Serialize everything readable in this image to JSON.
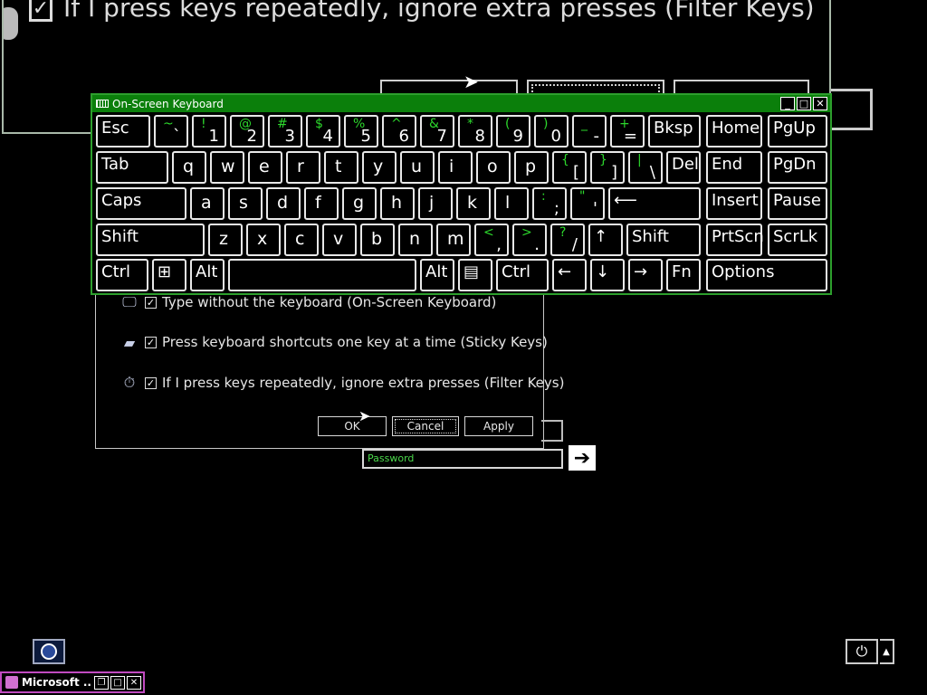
{
  "magnifier": {
    "option_text": "If I press keys repeatedly, ignore extra presses (Filter Keys)"
  },
  "ease_dialog": {
    "options": [
      {
        "label": "Type without the keyboard (On-Screen Keyboard)",
        "checked": true,
        "icon": "monitor-icon"
      },
      {
        "label": "Press keyboard shortcuts one key at a time (Sticky Keys)",
        "checked": true,
        "icon": "keyboard-key-icon"
      },
      {
        "label": "If I press keys repeatedly, ignore extra presses (Filter Keys)",
        "checked": true,
        "icon": "stopwatch-icon"
      }
    ],
    "buttons": {
      "ok": "OK",
      "cancel": "Cancel",
      "apply": "Apply"
    }
  },
  "logon": {
    "password_placeholder": "Password"
  },
  "osk": {
    "title": "On-Screen Keyboard",
    "row1": [
      {
        "s": "~",
        "l": "`"
      },
      {
        "s": "!",
        "l": "1"
      },
      {
        "s": "@",
        "l": "2"
      },
      {
        "s": "#",
        "l": "3"
      },
      {
        "s": "$",
        "l": "4"
      },
      {
        "s": "%",
        "l": "5"
      },
      {
        "s": "^",
        "l": "6"
      },
      {
        "s": "&",
        "l": "7"
      },
      {
        "s": "*",
        "l": "8"
      },
      {
        "s": "(",
        "l": "9"
      },
      {
        "s": ")",
        "l": "0"
      },
      {
        "s": "_",
        "l": "-"
      },
      {
        "s": "+",
        "l": "="
      }
    ],
    "row2_letters": [
      "q",
      "w",
      "e",
      "r",
      "t",
      "y",
      "u",
      "i",
      "o",
      "p"
    ],
    "row2_sym": [
      {
        "s": "{",
        "l": "["
      },
      {
        "s": "}",
        "l": "]"
      },
      {
        "s": "|",
        "l": "\\"
      }
    ],
    "row3_letters": [
      "a",
      "s",
      "d",
      "f",
      "g",
      "h",
      "j",
      "k",
      "l"
    ],
    "row3_sym": [
      {
        "s": ":",
        "l": ";"
      },
      {
        "s": "\"",
        "l": "'"
      }
    ],
    "row4_letters": [
      "z",
      "x",
      "c",
      "v",
      "b",
      "n",
      "m"
    ],
    "row4_sym": [
      {
        "s": "<",
        "l": ","
      },
      {
        "s": ">",
        "l": "."
      },
      {
        "s": "?",
        "l": "/"
      }
    ],
    "labels": {
      "esc": "Esc",
      "bksp": "Bksp",
      "tab": "Tab",
      "del": "Del",
      "caps": "Caps",
      "shift": "Shift",
      "ctrl": "Ctrl",
      "alt": "Alt",
      "fn": "Fn",
      "home": "Home",
      "pgup": "PgUp",
      "end": "End",
      "pgdn": "PgDn",
      "insert": "Insert",
      "pause": "Pause",
      "prtscn": "PrtScn",
      "scrlk": "ScrLk",
      "options": "Options",
      "up": "↑",
      "down": "↓",
      "left": "←",
      "right": "→",
      "enter": "⟵",
      "win": "⊞",
      "menu": "▤"
    }
  },
  "taskbar": {
    "app_label": "Microsoft ..."
  },
  "colors": {
    "osk_title_bg": "#0b7f0b",
    "shift_label": "#2cd82c",
    "password_text": "#4ad84a",
    "taskbar_border": "#c04ac0"
  }
}
